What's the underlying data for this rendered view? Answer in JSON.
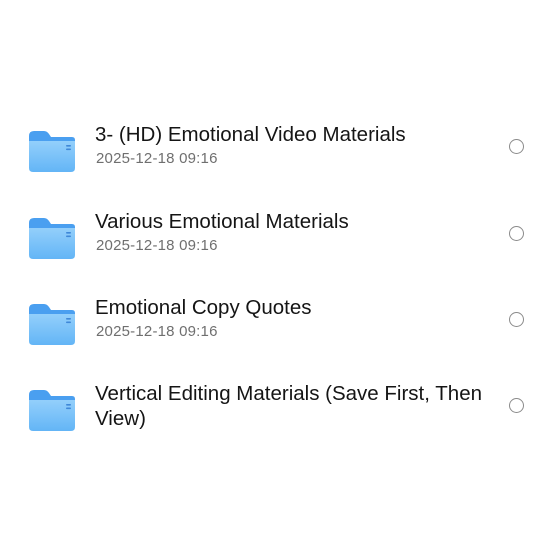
{
  "files": [
    {
      "name": "3- (HD) Emotional Video Materials",
      "date": "2025-12-18 09:16",
      "icon": "folder-icon",
      "selected": false
    },
    {
      "name": "Various Emotional Materials",
      "date": "2025-12-18 09:16",
      "icon": "folder-icon",
      "selected": false
    },
    {
      "name": "Emotional Copy Quotes",
      "date": "2025-12-18 09:16",
      "icon": "folder-icon",
      "selected": false
    },
    {
      "name": "Vertical Editing Materials (Save First, Then View)",
      "date": "",
      "icon": "folder-icon",
      "selected": false
    }
  ],
  "colors": {
    "folder_top": "#4a9ff0",
    "folder_front_top": "#93cffb",
    "folder_front_bottom": "#63b5f6",
    "folder_mark": "#3f88d8"
  }
}
